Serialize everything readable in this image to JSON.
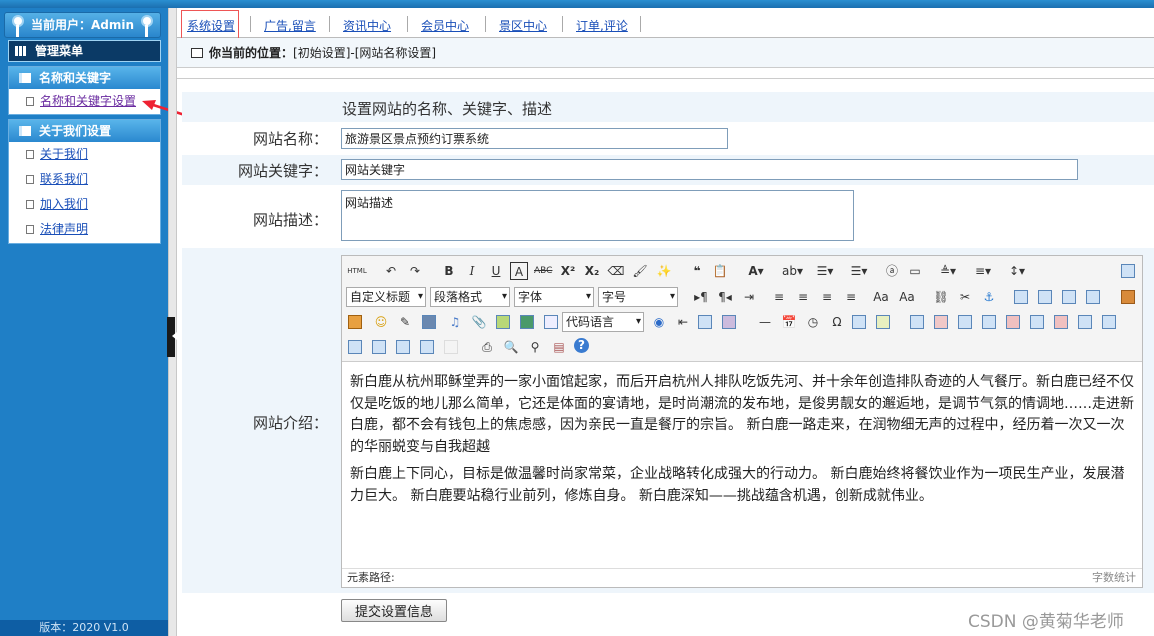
{
  "sidebar": {
    "user": "当前用户：Admin",
    "menu_title": "管理菜单",
    "panels": [
      {
        "title": "名称和关键字",
        "items": [
          "名称和关键字设置"
        ]
      },
      {
        "title": "关于我们设置",
        "items": [
          "关于我们",
          "联系我们",
          "加入我们",
          "法律声明"
        ]
      }
    ],
    "version": "版本：2020 V1.0"
  },
  "nav": {
    "items": [
      "系统设置",
      "广告,留言",
      "资讯中心",
      "会员中心",
      "景区中心",
      "订单,评论"
    ],
    "active": "系统设置"
  },
  "breadcrumb": {
    "label": "你当前的位置：",
    "path": "[初始设置]-[网站名称设置]"
  },
  "form": {
    "heading": "设置网站的名称、关键字、描述",
    "site_name_label": "网站名称：",
    "site_name_value": "旅游景区景点预约订票系统",
    "keywords_label": "网站关键字：",
    "keywords_value": "网站关键字",
    "description_label": "网站描述：",
    "description_value": "网站描述",
    "intro_label": "网站介绍：",
    "submit_label": "提交设置信息"
  },
  "editor": {
    "selects": [
      "自定义标题",
      "段落格式",
      "字体",
      "字号",
      "代码语言"
    ],
    "paragraphs": [
      "新白鹿从杭州耶稣堂弄的一家小面馆起家，而后开启杭州人排队吃饭先河、并十余年创造排队奇迹的人气餐厅。新白鹿已经不仅仅是吃饭的地儿那么简单，它还是体面的宴请地，是时尚潮流的发布地，是俊男靓女的邂逅地，是调节气氛的情调地……走进新白鹿，都不会有钱包上的焦虑感，因为亲民一直是餐厅的宗旨。 新白鹿一路走来，在润物细无声的过程中，经历着一次又一次的华丽蜕变与自我超越",
      "新白鹿上下同心，目标是做温馨时尚家常菜，企业战略转化成强大的行动力。 新白鹿始终将餐饮业作为一项民生产业，发展潜力巨大。 新白鹿要站稳行业前列，修炼自身。 新白鹿深知——挑战蕴含机遇，创新成就伟业。"
    ],
    "status_path": "元素路径:",
    "word_count": "字数统计"
  },
  "watermark": "CSDN @黄菊华老师",
  "colors": {
    "sidebar": "#1f7fc6",
    "link": "#1a4fb8",
    "highlight": "#e55555"
  }
}
